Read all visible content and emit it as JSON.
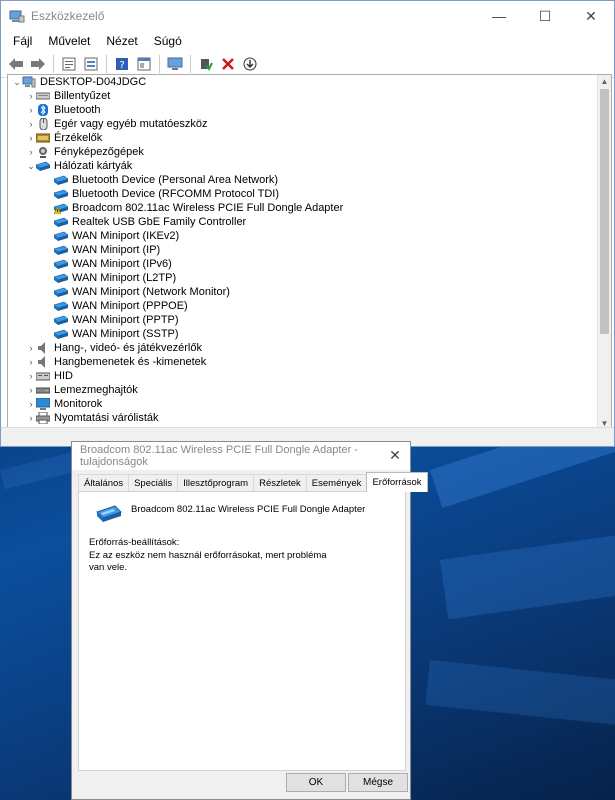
{
  "window": {
    "title": "Eszközkezelő",
    "controls": {
      "minimize": "—",
      "maximize": "☐",
      "close": "✕"
    }
  },
  "menubar": [
    "Fájl",
    "Művelet",
    "Nézet",
    "Súgó"
  ],
  "toolbar_icons": [
    "back-arrow-icon",
    "forward-arrow-icon",
    "properties-icon",
    "update-list-icon",
    "help-icon",
    "view-icon",
    "monitor-scan-icon",
    "enable-driver-icon",
    "uninstall-x-icon",
    "download-driver-icon"
  ],
  "tree": {
    "root": "DESKTOP-D04JDGC",
    "items": [
      {
        "label": "Billentyűzet",
        "expanded": false,
        "icon": "keyboard-icon"
      },
      {
        "label": "Bluetooth",
        "expanded": false,
        "icon": "bluetooth-icon"
      },
      {
        "label": "Egér vagy egyéb mutatóeszköz",
        "expanded": false,
        "icon": "mouse-icon"
      },
      {
        "label": "Érzékelők",
        "expanded": false,
        "icon": "sensor-icon"
      },
      {
        "label": "Fényképezőgépek",
        "expanded": false,
        "icon": "camera-icon"
      },
      {
        "label": "Hálózati kártyák",
        "expanded": true,
        "icon": "network-adapter-icon",
        "children": [
          {
            "label": "Bluetooth Device (Personal Area Network)",
            "warning": false
          },
          {
            "label": "Bluetooth Device (RFCOMM Protocol TDI)",
            "warning": false
          },
          {
            "label": "Broadcom 802.11ac Wireless PCIE Full Dongle Adapter",
            "warning": true
          },
          {
            "label": "Realtek USB GbE Family Controller",
            "warning": false
          },
          {
            "label": "WAN Miniport (IKEv2)",
            "warning": false
          },
          {
            "label": "WAN Miniport (IP)",
            "warning": false
          },
          {
            "label": "WAN Miniport (IPv6)",
            "warning": false
          },
          {
            "label": "WAN Miniport (L2TP)",
            "warning": false
          },
          {
            "label": "WAN Miniport (Network Monitor)",
            "warning": false
          },
          {
            "label": "WAN Miniport (PPPOE)",
            "warning": false
          },
          {
            "label": "WAN Miniport (PPTP)",
            "warning": false
          },
          {
            "label": "WAN Miniport (SSTP)",
            "warning": false
          }
        ]
      },
      {
        "label": "Hang-, videó- és játékvezérlők",
        "expanded": false,
        "icon": "speaker-icon"
      },
      {
        "label": "Hangbemenetek és -kimenetek",
        "expanded": false,
        "icon": "speaker-icon"
      },
      {
        "label": "HID",
        "expanded": false,
        "icon": "hid-icon"
      },
      {
        "label": "Lemezmeghajtók",
        "expanded": false,
        "icon": "disk-drive-icon"
      },
      {
        "label": "Monitorok",
        "expanded": false,
        "icon": "monitor-icon"
      },
      {
        "label": "Nyomtatási várólisták",
        "expanded": false,
        "icon": "printer-icon"
      }
    ]
  },
  "dialog": {
    "title": "Broadcom 802.11ac Wireless PCIE Full Dongle Adapter - tulajdonságok",
    "tabs": [
      "Általános",
      "Speciális",
      "Illesztőprogram",
      "Részletek",
      "Események",
      "Erőforrások"
    ],
    "active_tab": 5,
    "device_name": "Broadcom 802.11ac Wireless PCIE Full Dongle Adapter",
    "resources_label": "Erőforrás-beállítások:",
    "resources_message": "Ez az eszköz nem használ erőforrásokat, mert probléma van vele.",
    "ok_label": "OK",
    "cancel_label": "Mégse",
    "close_glyph": "✕"
  },
  "colors": {
    "accent": "#0078d7",
    "warning": "#f2c200",
    "network_icon": "#2a8ad8"
  }
}
